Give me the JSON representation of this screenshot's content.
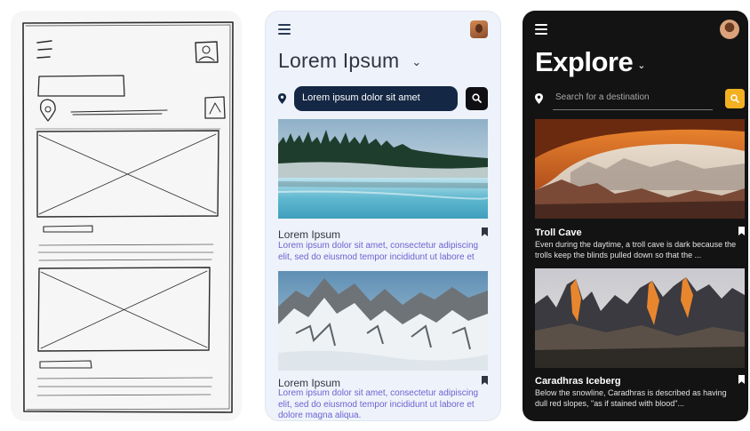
{
  "light_screen": {
    "title": "Lorem Ipsum",
    "search_value": "Lorem ipsum dolor sit amet",
    "cards": [
      {
        "title": "Lorem Ipsum",
        "description": "Lorem ipsum dolor sit amet, consectetur adipiscing elit, sed do eiusmod tempor incididunt ut labore et"
      },
      {
        "title": "Lorem Ipsum",
        "description": "Lorem ipsum dolor sit amet, consectetur adipiscing elit, sed do eiusmod tempor incididunt ut labore et dolore magna aliqua."
      }
    ]
  },
  "dark_screen": {
    "title": "Explore",
    "search_placeholder": "Search for a destination",
    "cards": [
      {
        "title": "Troll Cave",
        "description": "Even during the daytime, a troll cave is dark because the trolls keep the blinds pulled down so that the ..."
      },
      {
        "title": "Caradhras Iceberg",
        "description": "Below the snowline, Caradhras is described as having dull red slopes, \"as if stained with blood\"..."
      }
    ]
  },
  "icons": {
    "menu": "hamburger-menu-icon",
    "avatar": "user-avatar",
    "chevron": "chevron-down-icon",
    "location": "location-pin-icon",
    "search": "search-icon",
    "bookmark": "bookmark-icon"
  },
  "colors": {
    "light_bg": "#eef3fb",
    "light_search_bg": "#142744",
    "light_link_text": "#6b62d0",
    "dark_bg": "#131313",
    "dark_accent": "#f3b021"
  }
}
